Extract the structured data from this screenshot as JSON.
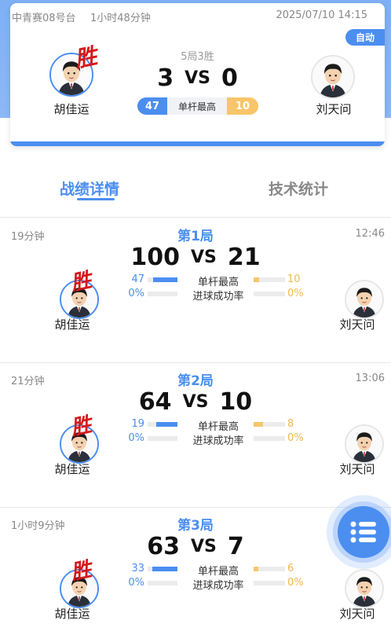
{
  "header": {
    "venue": "中青赛08号台",
    "duration": "1小时48分钟",
    "datetime": "2025/07/10 14:15",
    "mode_badge": "自动",
    "format": "5局3胜",
    "score_left": "3",
    "vs": "VS",
    "score_right": "0",
    "high_break_left": "47",
    "high_break_label": "单杆最高",
    "high_break_right": "10"
  },
  "players": {
    "left": "胡佳运",
    "right": "刘天问",
    "win_mark": "胜"
  },
  "tabs": [
    {
      "label": "战绩详情",
      "active": true
    },
    {
      "label": "技术统计",
      "active": false
    }
  ],
  "games": [
    {
      "title": "第1局",
      "elapsed": "19分钟",
      "clock": "12:46",
      "score_left": "100",
      "score_right": "21",
      "stats": [
        {
          "label": "单杆最高",
          "left": "47",
          "right": "10",
          "left_fill": 0.82,
          "right_fill": 0.18
        },
        {
          "label": "进球成功率",
          "left": "0%",
          "right": "0%",
          "left_fill": 0,
          "right_fill": 0
        }
      ]
    },
    {
      "title": "第2局",
      "elapsed": "21分钟",
      "clock": "13:06",
      "score_left": "64",
      "score_right": "10",
      "stats": [
        {
          "label": "单杆最高",
          "left": "19",
          "right": "8",
          "left_fill": 0.7,
          "right_fill": 0.3
        },
        {
          "label": "进球成功率",
          "left": "0%",
          "right": "0%",
          "left_fill": 0,
          "right_fill": 0
        }
      ]
    },
    {
      "title": "第3局",
      "elapsed": "1小时9分钟",
      "clock": "",
      "score_left": "63",
      "score_right": "7",
      "stats": [
        {
          "label": "单杆最高",
          "left": "33",
          "right": "6",
          "left_fill": 0.85,
          "right_fill": 0.15
        },
        {
          "label": "进球成功率",
          "left": "0%",
          "right": "0%",
          "left_fill": 0,
          "right_fill": 0
        }
      ]
    }
  ],
  "colors": {
    "accent": "#4b8ef0",
    "gold": "#f8c56a",
    "win": "#d41a1a"
  },
  "icons": {
    "fab": "list-menu-icon",
    "avatar": "player-avatar-icon"
  }
}
